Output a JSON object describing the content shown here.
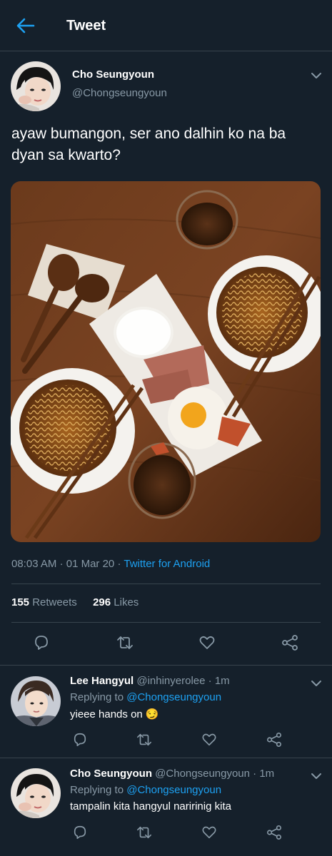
{
  "header": {
    "title": "Tweet",
    "back_icon": "back-arrow-icon"
  },
  "tweet": {
    "author_name": "Cho Seungyoun",
    "author_handle": "@Chongseungyoun",
    "text": "ayaw bumangon, ser ano dalhin ko na ba dyan sa kwarto?",
    "time": "08:03 AM",
    "date": "01 Mar 20",
    "source": "Twitter for Android",
    "retweets_count": "155",
    "retweets_label": "Retweets",
    "likes_count": "296",
    "likes_label": "Likes"
  },
  "actions": {
    "reply": "reply-icon",
    "retweet": "retweet-icon",
    "like": "heart-icon",
    "share": "share-icon"
  },
  "replies": [
    {
      "name": "Lee Hangyul",
      "handle": "@inhinyerolee",
      "time": "1m",
      "replying_label": "Replying to",
      "replying_to": "@Chongseungyoun",
      "text": "yieee hands on",
      "emoji": "😏"
    },
    {
      "name": "Cho Seungyoun",
      "handle": "@Chongseungyoun",
      "time": "1m",
      "replying_label": "Replying to",
      "replying_to": "@Chongseungyoun",
      "text": "tampalin kita hangyul naririnig kita"
    }
  ],
  "colors": {
    "background": "#15202b",
    "accent": "#1da1f2",
    "secondary_text": "#8899a6",
    "divider": "#38444d"
  }
}
